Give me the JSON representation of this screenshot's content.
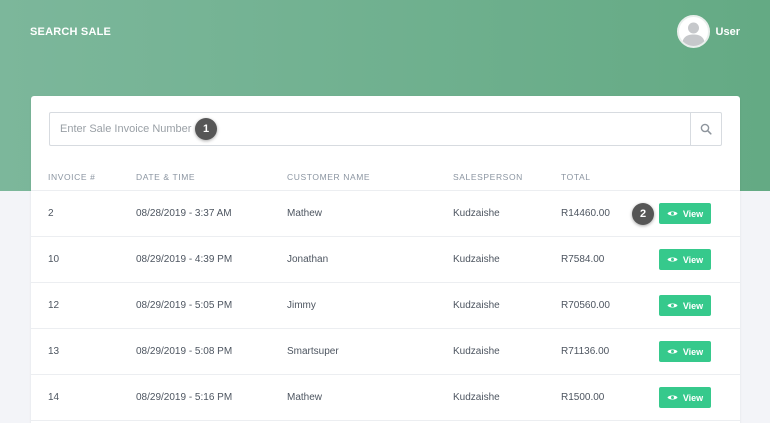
{
  "header": {
    "title": "SEARCH SALE",
    "user_label": "User"
  },
  "search": {
    "placeholder": "Enter Sale Invoice Number",
    "step_badge": "1"
  },
  "table": {
    "columns": [
      "INVOICE #",
      "DATE & TIME",
      "CUSTOMER NAME",
      "SALESPERSON",
      "TOTAL"
    ],
    "rows": [
      {
        "invoice": "2",
        "datetime": "08/28/2019 - 3:37 AM",
        "customer": "Mathew",
        "salesperson": "Kudzaishe",
        "total": "R14460.00",
        "action": "View"
      },
      {
        "invoice": "10",
        "datetime": "08/29/2019 - 4:39 PM",
        "customer": "Jonathan",
        "salesperson": "Kudzaishe",
        "total": "R7584.00",
        "action": "View"
      },
      {
        "invoice": "12",
        "datetime": "08/29/2019 - 5:05 PM",
        "customer": "Jimmy",
        "salesperson": "Kudzaishe",
        "total": "R70560.00",
        "action": "View"
      },
      {
        "invoice": "13",
        "datetime": "08/29/2019 - 5:08 PM",
        "customer": "Smartsuper",
        "salesperson": "Kudzaishe",
        "total": "R71136.00",
        "action": "View"
      },
      {
        "invoice": "14",
        "datetime": "08/29/2019 - 5:16 PM",
        "customer": "Mathew",
        "salesperson": "Kudzaishe",
        "total": "R1500.00",
        "action": "View"
      }
    ],
    "step_badge": "2"
  },
  "icons": {
    "avatar": "user-avatar-icon",
    "search": "search-icon",
    "view": "eye-icon"
  },
  "colors": {
    "header_gradient_start": "#7cb79b",
    "header_gradient_end": "#64aa84",
    "view_button": "#36c98c",
    "badge": "#565656"
  }
}
